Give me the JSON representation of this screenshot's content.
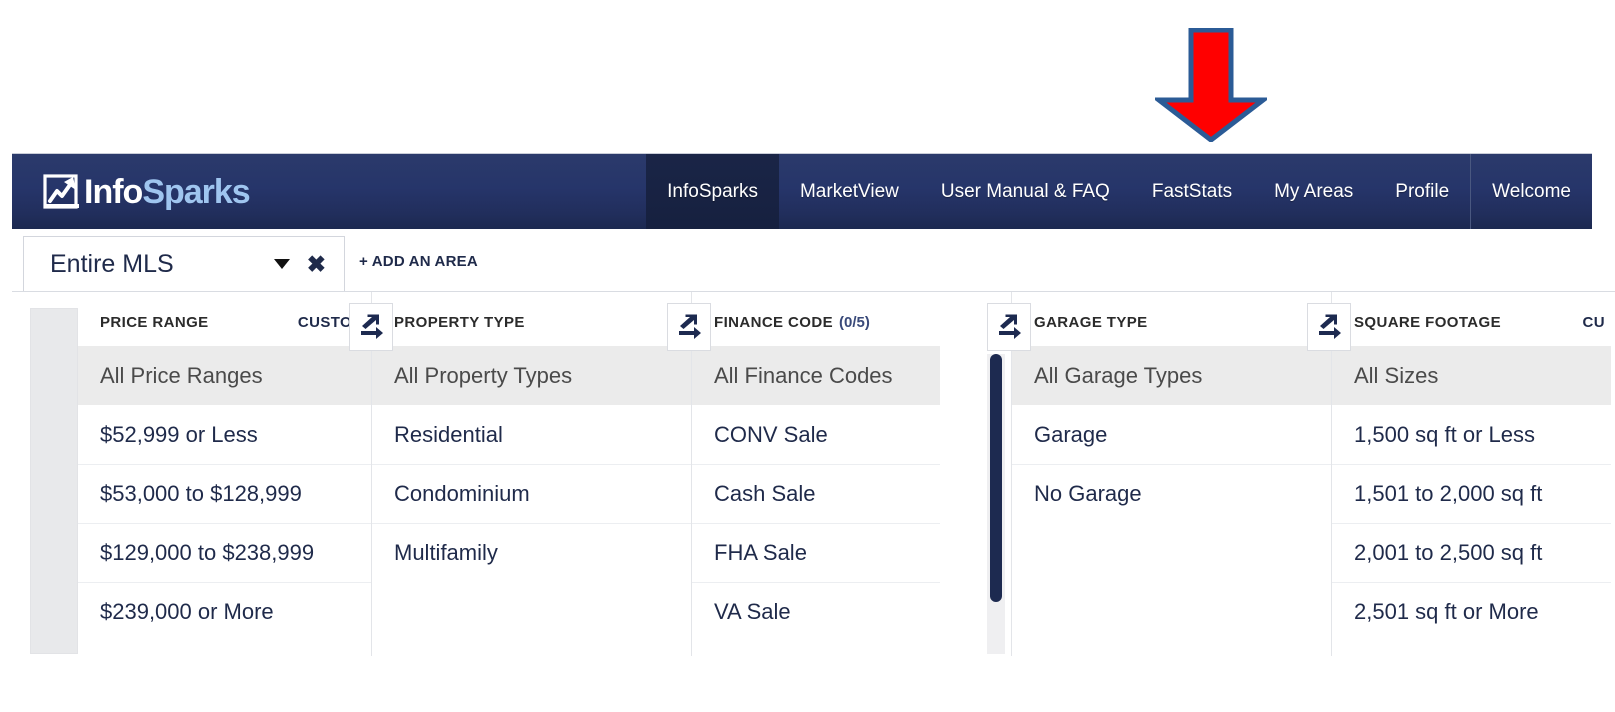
{
  "brand": {
    "logo_info": "Info",
    "logo_sparks": "Sparks",
    "logo_icon": "chart-arrow-icon",
    "navbar_color": "#26356a",
    "accent_color": "#9fc5ef"
  },
  "nav": {
    "items": [
      {
        "label": "InfoSparks",
        "active": true
      },
      {
        "label": "MarketView",
        "active": false
      },
      {
        "label": "User Manual & FAQ",
        "active": false
      },
      {
        "label": "FastStats",
        "active": false
      },
      {
        "label": "My Areas",
        "active": false
      },
      {
        "label": "Profile",
        "active": false
      }
    ],
    "welcome": "Welcome"
  },
  "area_bar": {
    "selected_area": "Entire MLS",
    "caret_icon": "chevron-down-icon",
    "close_icon": "close-icon",
    "add_area_label": "+ ADD AN AREA"
  },
  "annotation": {
    "arrow_icon": "down-arrow-icon",
    "fill": "#ff0000",
    "stroke": "#2b5b96"
  },
  "filters": {
    "expand_icon": "expand-arrows-icon",
    "columns": [
      {
        "title": "PRICE RANGE",
        "count": "",
        "custom_label": "CUSTOM",
        "options": [
          "All Price Ranges",
          "$52,999 or Less",
          "$53,000 to $128,999",
          "$129,000 to $238,999",
          "$239,000 or More"
        ],
        "has_scrollbar": false
      },
      {
        "title": "PROPERTY TYPE",
        "count": "",
        "custom_label": "",
        "options": [
          "All Property Types",
          "Residential",
          "Condominium",
          "Multifamily"
        ],
        "has_scrollbar": false
      },
      {
        "title": "FINANCE CODE",
        "count": "(0/5)",
        "custom_label": "",
        "options": [
          "All Finance Codes",
          "CONV Sale",
          "Cash Sale",
          "FHA Sale",
          "VA Sale"
        ],
        "has_scrollbar": true
      },
      {
        "title": "GARAGE TYPE",
        "count": "",
        "custom_label": "",
        "options": [
          "All Garage Types",
          "Garage",
          "No Garage"
        ],
        "has_scrollbar": false
      },
      {
        "title": "SQUARE FOOTAGE",
        "count": "",
        "custom_label": "CU",
        "options": [
          "All Sizes",
          "1,500 sq ft or Less",
          "1,501 to 2,000 sq ft",
          "2,001 to 2,500 sq ft",
          "2,501 sq ft or More"
        ],
        "has_scrollbar": false
      }
    ]
  }
}
